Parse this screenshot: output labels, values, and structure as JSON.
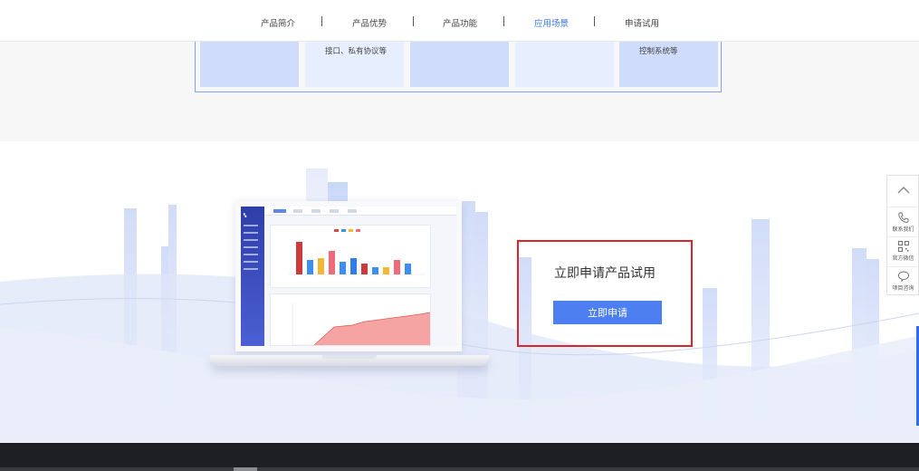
{
  "nav": {
    "items": [
      {
        "label": "产品简介",
        "active": false
      },
      {
        "label": "产品优势",
        "active": false
      },
      {
        "label": "产品功能",
        "active": false
      },
      {
        "label": "应用场景",
        "active": true
      },
      {
        "label": "申请试用",
        "active": false
      }
    ],
    "separator": "|"
  },
  "cards": {
    "card2_text": "接口、私有协议等",
    "card5_text": "控制系统等"
  },
  "cta": {
    "title": "立即申请产品试用",
    "button_label": "立即申请"
  },
  "side_tools": {
    "contact_label": "联系我们",
    "wechat_label": "官方微信",
    "consult_label": "项目咨询"
  },
  "colors": {
    "accent": "#4d7ff0",
    "active_nav": "#3d77e8",
    "highlight_border": "#d9262c",
    "footer": "#1e1f24"
  },
  "icons": [
    "chevron-up-icon",
    "phone-icon",
    "qrcode-icon",
    "chat-bubble-icon"
  ]
}
